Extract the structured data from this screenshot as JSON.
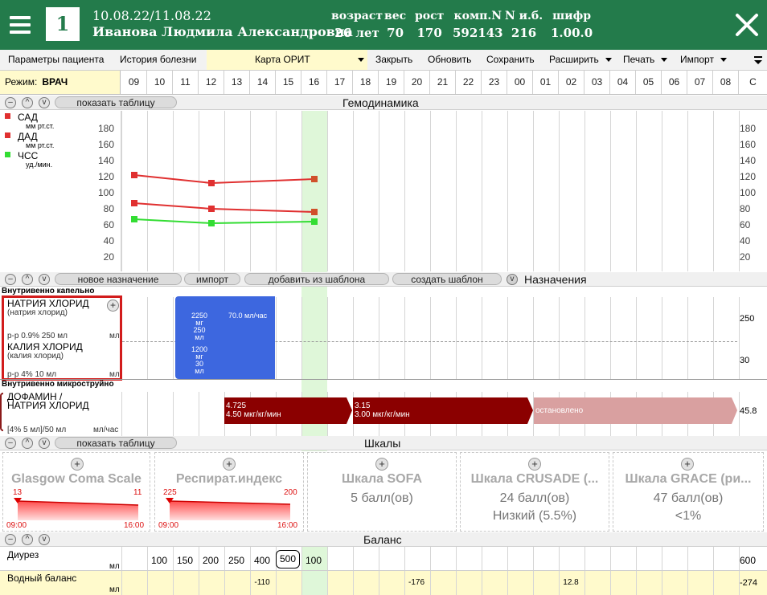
{
  "header": {
    "bed_number": "1",
    "dates": "10.08.22/11.08.22",
    "patient_name": "Иванова Людмила Александровна",
    "stats": [
      {
        "label": "возраст",
        "value": "26 лет"
      },
      {
        "label": "вес",
        "value": "70"
      },
      {
        "label": "рост",
        "value": "170"
      },
      {
        "label": "комп.N",
        "value": "592143"
      },
      {
        "label": "N и.б.",
        "value": "216"
      },
      {
        "label": "шифр",
        "value": "1.00.0"
      }
    ]
  },
  "toolbar": {
    "items": [
      "Параметры пациента",
      "История болезни",
      "Карта ОРИТ",
      "Закрыть",
      "Обновить",
      "Сохранить",
      "Расширить",
      "Печать",
      "Импорт"
    ]
  },
  "mode": {
    "label": "Режим:",
    "value": "ВРАЧ"
  },
  "hours": [
    "09",
    "10",
    "11",
    "12",
    "13",
    "14",
    "15",
    "16",
    "17",
    "18",
    "19",
    "20",
    "21",
    "22",
    "23",
    "00",
    "01",
    "02",
    "03",
    "04",
    "05",
    "06",
    "07",
    "08",
    "C"
  ],
  "hemo": {
    "title": "Гемодинамика",
    "show_table": "показать таблицу",
    "legend": [
      {
        "name": "САД",
        "unit": "мм рт.ст.",
        "color": "#e03030"
      },
      {
        "name": "ДАД",
        "unit": "мм рт.ст.",
        "color": "#e03030"
      },
      {
        "name": "ЧСС",
        "unit": "уд./мин.",
        "color": "#33dd33"
      }
    ],
    "yticks": [
      "180",
      "160",
      "140",
      "120",
      "100",
      "80",
      "60",
      "40",
      "20"
    ]
  },
  "chart_data": {
    "type": "line",
    "x": [
      "09",
      "12",
      "16"
    ],
    "ylim": [
      0,
      190
    ],
    "series": [
      {
        "name": "САД",
        "color": "#e03030",
        "values": [
          120,
          110,
          115
        ]
      },
      {
        "name": "ДАД",
        "color": "#e03030",
        "values": [
          85,
          78,
          74
        ]
      },
      {
        "name": "ЧСС",
        "color": "#33dd33",
        "values": [
          65,
          60,
          62
        ]
      }
    ]
  },
  "prescr": {
    "title": "Назначения",
    "buttons": [
      "новое назначение",
      "импорт",
      "добавить из шаблона",
      "создать шаблон"
    ],
    "drip_label": "Внутривенно капельно",
    "drug1": {
      "name": "НАТРИЯ ХЛОРИД",
      "sub": "(натрия хлорид)",
      "form": "р-р 0.9% 250 мл",
      "unit": "мл",
      "dose": "2250",
      "dose_u": "мг",
      "vol": "250",
      "vol_u": "мл",
      "total": "250"
    },
    "drug2": {
      "name": "КАЛИЯ ХЛОРИД",
      "sub": "(калия хлорид)",
      "form": "р-р 4% 10 мл",
      "unit": "мл",
      "dose": "1200",
      "dose_u": "мг",
      "vol": "30",
      "vol_u": "мл",
      "total": "30"
    },
    "rate": "70.0 мл/час",
    "micro_label": "Внутривенно микроструйно",
    "drug3": {
      "name": "ДОФАМИН /",
      "name2": "НАТРИЯ ХЛОРИД",
      "form": "[4%  5 мл]/50 мл",
      "unit": "мл/час",
      "total": "45.8"
    },
    "seg1": {
      "a": "4.725",
      "b": "4.50 мкг/кг/мин"
    },
    "seg2": {
      "a": "3.15",
      "b": "3.00 мкг/кг/мин"
    },
    "seg3": "остановлено"
  },
  "scales": {
    "title": "Шкалы",
    "show_table": "показать таблицу",
    "cards": [
      {
        "name": "Glasgow Coma Scale",
        "v1": "13",
        "v2": "11",
        "t1": "09:00",
        "t2": "16:00"
      },
      {
        "name": "Респират.индекс",
        "v1": "225",
        "v2": "200",
        "t1": "09:00",
        "t2": "16:00"
      },
      {
        "name": "Шкала SOFA",
        "line1": "5 балл(ов)",
        "line2": ""
      },
      {
        "name": "Шкала CRUSADE (...",
        "line1": "24 балл(ов)",
        "line2": "Низкий (5.5%)"
      },
      {
        "name": "Шкала GRACE (ри...",
        "line1": "47 балл(ов)",
        "line2": "<1%"
      }
    ]
  },
  "balance": {
    "title": "Баланс",
    "diuresis": {
      "label": "Диурез",
      "unit": "мл",
      "values": [
        "100",
        "150",
        "200",
        "250",
        "400",
        "500",
        "100"
      ],
      "total": "600"
    },
    "water": {
      "label": "Водный баланс",
      "unit": "мл",
      "values": [
        "-110",
        "-176",
        "12.8"
      ],
      "total": "-274"
    }
  },
  "colors": {
    "header": "#237b4b",
    "highlight_col": "#dff7d9",
    "blue": "#3d67df",
    "dark_red": "#8b0000",
    "light_red": "#d9a0a0"
  }
}
